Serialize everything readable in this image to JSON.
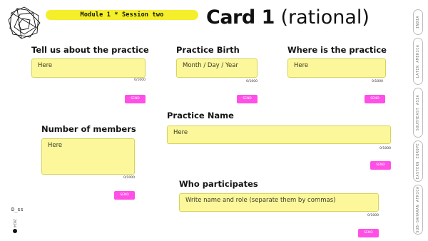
{
  "header": {
    "module_label": "Module 1 * Session two",
    "title_bold": "Card 1",
    "title_light": "(rational)"
  },
  "sidebar_tabs": [
    "INDIA",
    "LATIN AMERICA",
    "SOUTHEAST ASIA",
    "EASTERN EUROPE",
    "SUB-SAHARAN AFRICA"
  ],
  "footer": {
    "brand": "D_ss",
    "year": "2024"
  },
  "fields": {
    "practice": {
      "label": "Tell us about the practice",
      "placeholder": "Here",
      "counter": "0/1000",
      "send": "SEND"
    },
    "birth": {
      "label": "Practice Birth",
      "placeholder": "Month / Day / Year",
      "counter": "0/1000",
      "send": "SEND"
    },
    "where": {
      "label": "Where is the practice",
      "placeholder": "Here",
      "counter": "0/1000",
      "send": "SEND"
    },
    "name": {
      "label": "Practice Name",
      "placeholder": "Here",
      "counter": "0/1000",
      "send": "SEND"
    },
    "members": {
      "label": "Number of members",
      "placeholder": "Here",
      "counter": "0/1000",
      "send": "SEND"
    },
    "participates": {
      "label": "Who participates",
      "placeholder": "Write name and role (separate them by commas)",
      "counter": "0/1000",
      "send": "SEND"
    }
  },
  "colors": {
    "field_bg": "#fbf79a",
    "send_bg": "#ff4fe6",
    "pill_bg": "#f4ef2a"
  },
  "icons": {
    "logo": "geometric-logo-icon",
    "dot": "dot-icon"
  }
}
